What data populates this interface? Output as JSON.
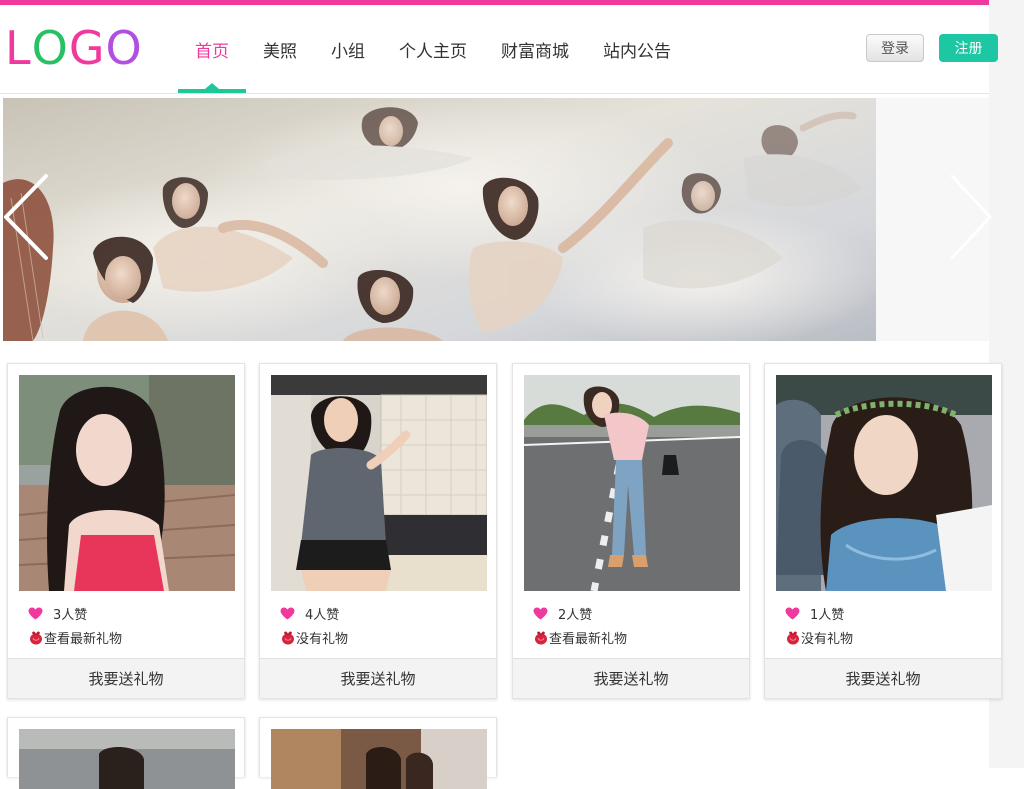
{
  "brand": {
    "logo_letters": [
      {
        "char": "L",
        "color": "#f0399c"
      },
      {
        "char": "O",
        "color": "#27c063"
      },
      {
        "char": "G",
        "color": "#f0399c"
      },
      {
        "char": "O",
        "color": "#b34fe0"
      }
    ],
    "accent_pink": "#f0399c",
    "accent_green": "#1ec79a"
  },
  "nav": {
    "items": [
      {
        "label": "首页",
        "active": true
      },
      {
        "label": "美照",
        "active": false
      },
      {
        "label": "小组",
        "active": false
      },
      {
        "label": "个人主页",
        "active": false
      },
      {
        "label": "财富商城",
        "active": false
      },
      {
        "label": "站内公告",
        "active": false
      }
    ]
  },
  "auth": {
    "login_label": "登录",
    "register_label": "注册"
  },
  "banner": {
    "prev_icon": "chevron-left-icon",
    "next_icon": "chevron-right-icon"
  },
  "cards": [
    {
      "likes": "3人赞",
      "gift_text": "查看最新礼物",
      "button": "我要送礼物"
    },
    {
      "likes": "4人赞",
      "gift_text": "没有礼物",
      "button": "我要送礼物"
    },
    {
      "likes": "2人赞",
      "gift_text": "查看最新礼物",
      "button": "我要送礼物"
    },
    {
      "likes": "1人赞",
      "gift_text": "没有礼物",
      "button": "我要送礼物"
    }
  ],
  "icons": {
    "like": "heart-icon",
    "gift": "gift-icon"
  }
}
